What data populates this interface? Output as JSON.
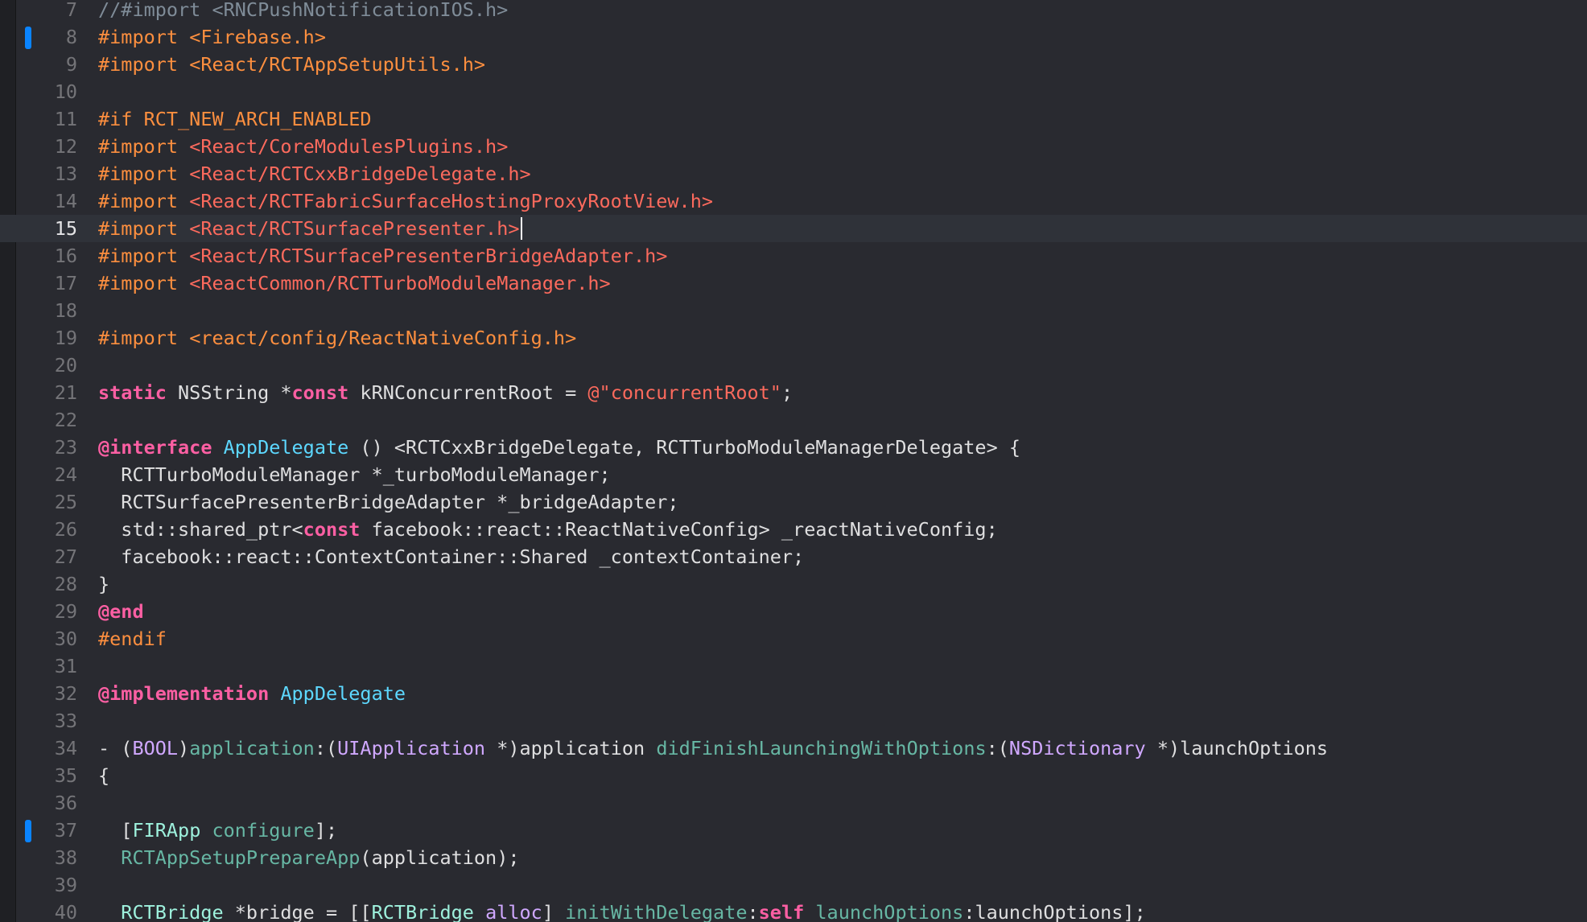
{
  "editor": {
    "current_line": 15,
    "lines": [
      {
        "n": "7",
        "changed": false,
        "tokens": [
          {
            "t": "//#import <RNCPushNotificationIOS.h>",
            "c": "comment"
          }
        ]
      },
      {
        "n": "8",
        "changed": true,
        "tokens": [
          {
            "t": "#import ",
            "c": "pre"
          },
          {
            "t": "<Firebase.h>",
            "c": "pre"
          }
        ]
      },
      {
        "n": "9",
        "changed": false,
        "tokens": [
          {
            "t": "#import ",
            "c": "pre"
          },
          {
            "t": "<React/RCTAppSetupUtils.h>",
            "c": "pre"
          }
        ]
      },
      {
        "n": "10",
        "changed": false,
        "tokens": []
      },
      {
        "n": "11",
        "changed": false,
        "tokens": [
          {
            "t": "#if RCT_NEW_ARCH_ENABLED",
            "c": "pre"
          }
        ]
      },
      {
        "n": "12",
        "changed": false,
        "tokens": [
          {
            "t": "#import ",
            "c": "pre"
          },
          {
            "t": "<React/CoreModulesPlugins.h>",
            "c": "str"
          }
        ]
      },
      {
        "n": "13",
        "changed": false,
        "tokens": [
          {
            "t": "#import ",
            "c": "pre"
          },
          {
            "t": "<React/RCTCxxBridgeDelegate.h>",
            "c": "str"
          }
        ]
      },
      {
        "n": "14",
        "changed": false,
        "tokens": [
          {
            "t": "#import ",
            "c": "pre"
          },
          {
            "t": "<React/RCTFabricSurfaceHostingProxyRootView.h>",
            "c": "str"
          }
        ]
      },
      {
        "n": "15",
        "changed": false,
        "caret": true,
        "tokens": [
          {
            "t": "#import ",
            "c": "pre"
          },
          {
            "t": "<React/RCTSurfacePresenter.h>",
            "c": "str"
          }
        ]
      },
      {
        "n": "16",
        "changed": false,
        "tokens": [
          {
            "t": "#import ",
            "c": "pre"
          },
          {
            "t": "<React/RCTSurfacePresenterBridgeAdapter.h>",
            "c": "str"
          }
        ]
      },
      {
        "n": "17",
        "changed": false,
        "tokens": [
          {
            "t": "#import ",
            "c": "pre"
          },
          {
            "t": "<ReactCommon/RCTTurboModuleManager.h>",
            "c": "str"
          }
        ]
      },
      {
        "n": "18",
        "changed": false,
        "tokens": []
      },
      {
        "n": "19",
        "changed": false,
        "tokens": [
          {
            "t": "#import ",
            "c": "pre"
          },
          {
            "t": "<react/config/ReactNativeConfig.h>",
            "c": "pre"
          }
        ]
      },
      {
        "n": "20",
        "changed": false,
        "tokens": []
      },
      {
        "n": "21",
        "changed": false,
        "tokens": [
          {
            "t": "static",
            "c": "kw"
          },
          {
            "t": " NSString *",
            "c": "plain"
          },
          {
            "t": "const",
            "c": "kw"
          },
          {
            "t": " kRNConcurrentRoot = ",
            "c": "plain"
          },
          {
            "t": "@\"concurrentRoot\"",
            "c": "str"
          },
          {
            "t": ";",
            "c": "plain"
          }
        ]
      },
      {
        "n": "22",
        "changed": false,
        "tokens": []
      },
      {
        "n": "23",
        "changed": false,
        "tokens": [
          {
            "t": "@interface",
            "c": "kw"
          },
          {
            "t": " ",
            "c": "plain"
          },
          {
            "t": "AppDelegate",
            "c": "typedecl"
          },
          {
            "t": " () <RCTCxxBridgeDelegate, RCTTurboModuleManagerDelegate> {",
            "c": "plain"
          }
        ]
      },
      {
        "n": "24",
        "changed": false,
        "tokens": [
          {
            "t": "  RCTTurboModuleManager *_turboModuleManager;",
            "c": "plain"
          }
        ]
      },
      {
        "n": "25",
        "changed": false,
        "tokens": [
          {
            "t": "  RCTSurfacePresenterBridgeAdapter *_bridgeAdapter;",
            "c": "plain"
          }
        ]
      },
      {
        "n": "26",
        "changed": false,
        "tokens": [
          {
            "t": "  std::shared_ptr<",
            "c": "plain"
          },
          {
            "t": "const",
            "c": "kw"
          },
          {
            "t": " facebook::react::ReactNativeConfig> _reactNativeConfig;",
            "c": "plain"
          }
        ]
      },
      {
        "n": "27",
        "changed": false,
        "tokens": [
          {
            "t": "  facebook::react::ContextContainer::Shared _contextContainer;",
            "c": "plain"
          }
        ]
      },
      {
        "n": "28",
        "changed": false,
        "tokens": [
          {
            "t": "}",
            "c": "plain"
          }
        ]
      },
      {
        "n": "29",
        "changed": false,
        "tokens": [
          {
            "t": "@end",
            "c": "kw"
          }
        ]
      },
      {
        "n": "30",
        "changed": false,
        "tokens": [
          {
            "t": "#endif",
            "c": "pre"
          }
        ]
      },
      {
        "n": "31",
        "changed": false,
        "tokens": []
      },
      {
        "n": "32",
        "changed": false,
        "tokens": [
          {
            "t": "@implementation",
            "c": "kw"
          },
          {
            "t": " ",
            "c": "plain"
          },
          {
            "t": "AppDelegate",
            "c": "typedecl"
          }
        ]
      },
      {
        "n": "33",
        "changed": false,
        "tokens": []
      },
      {
        "n": "34",
        "changed": false,
        "tokens": [
          {
            "t": "- (",
            "c": "plain"
          },
          {
            "t": "BOOL",
            "c": "type"
          },
          {
            "t": ")",
            "c": "plain"
          },
          {
            "t": "application",
            "c": "method"
          },
          {
            "t": ":(",
            "c": "plain"
          },
          {
            "t": "UIApplication",
            "c": "type"
          },
          {
            "t": " *)application ",
            "c": "plain"
          },
          {
            "t": "didFinishLaunchingWithOptions",
            "c": "method"
          },
          {
            "t": ":(",
            "c": "plain"
          },
          {
            "t": "NSDictionary",
            "c": "type"
          },
          {
            "t": " *)launchOptions",
            "c": "plain"
          }
        ]
      },
      {
        "n": "35",
        "changed": false,
        "tokens": [
          {
            "t": "{",
            "c": "plain"
          }
        ]
      },
      {
        "n": "36",
        "changed": false,
        "tokens": []
      },
      {
        "n": "37",
        "changed": true,
        "tokens": [
          {
            "t": "  [",
            "c": "plain"
          },
          {
            "t": "FIRApp",
            "c": "cls"
          },
          {
            "t": " ",
            "c": "plain"
          },
          {
            "t": "configure",
            "c": "method"
          },
          {
            "t": "];",
            "c": "plain"
          }
        ]
      },
      {
        "n": "38",
        "changed": false,
        "tokens": [
          {
            "t": "  ",
            "c": "plain"
          },
          {
            "t": "RCTAppSetupPrepareApp",
            "c": "method"
          },
          {
            "t": "(application);",
            "c": "plain"
          }
        ]
      },
      {
        "n": "39",
        "changed": false,
        "tokens": []
      },
      {
        "n": "40",
        "changed": false,
        "tokens": [
          {
            "t": "  ",
            "c": "plain"
          },
          {
            "t": "RCTBridge",
            "c": "cls"
          },
          {
            "t": " *bridge = [[",
            "c": "plain"
          },
          {
            "t": "RCTBridge",
            "c": "cls"
          },
          {
            "t": " ",
            "c": "plain"
          },
          {
            "t": "alloc",
            "c": "type"
          },
          {
            "t": "] ",
            "c": "plain"
          },
          {
            "t": "initWithDelegate",
            "c": "method"
          },
          {
            "t": ":",
            "c": "plain"
          },
          {
            "t": "self",
            "c": "kw"
          },
          {
            "t": " ",
            "c": "plain"
          },
          {
            "t": "launchOptions",
            "c": "method"
          },
          {
            "t": ":launchOptions];",
            "c": "plain"
          }
        ]
      }
    ]
  }
}
